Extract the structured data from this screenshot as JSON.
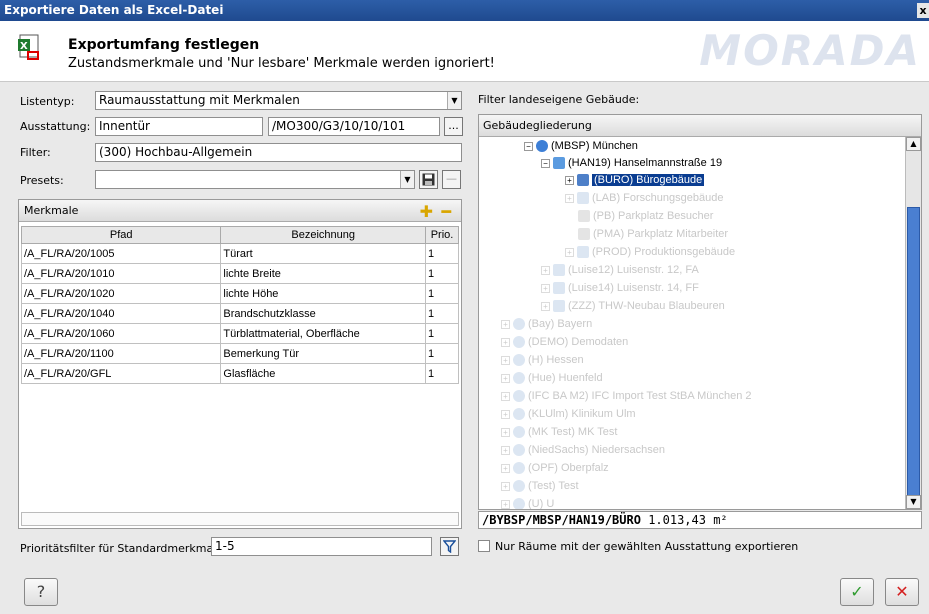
{
  "window": {
    "title": "Exportiere Daten als Excel-Datei",
    "close": "x"
  },
  "header": {
    "title": "Exportumfang festlegen",
    "subtitle": "Zustandsmerkmale und 'Nur lesbare' Merkmale werden ignoriert!",
    "watermark": "MORADA"
  },
  "form": {
    "listentyp_label": "Listentyp:",
    "listentyp_value": "Raumausstattung mit Merkmalen",
    "ausstattung_label": "Ausstattung:",
    "ausstattung_value": "Innentür",
    "ausstattung_path": "/MO300/G3/10/10/101",
    "browse_label": "...",
    "filter_label": "Filter:",
    "filter_value": "(300) Hochbau-Allgemein",
    "presets_label": "Presets:",
    "presets_value": ""
  },
  "merkmale": {
    "title": "Merkmale",
    "columns": [
      "Pfad",
      "Bezeichnung",
      "Prio."
    ],
    "rows": [
      [
        "/A_FL/RA/20/1005",
        "Türart",
        "1"
      ],
      [
        "/A_FL/RA/20/1010",
        "lichte Breite",
        "1"
      ],
      [
        "/A_FL/RA/20/1020",
        "lichte Höhe",
        "1"
      ],
      [
        "/A_FL/RA/20/1040",
        "Brandschutzklasse",
        "1"
      ],
      [
        "/A_FL/RA/20/1060",
        "Türblattmaterial, Oberfläche",
        "1"
      ],
      [
        "/A_FL/RA/20/1100",
        "Bemerkung Tür",
        "1"
      ],
      [
        "/A_FL/RA/20/GFL",
        "Glasfläche",
        "1"
      ]
    ]
  },
  "prio_filter": {
    "label": "Prioritätsfilter für Standardmerkmale:",
    "value": "1-5"
  },
  "right": {
    "filter_label": "Filter landeseigene Gebäude:",
    "tree_header": "Gebäudegliederung",
    "nodes": [
      "(MBSP) München",
      "(HAN19) Hanselmannstraße 19",
      "(BÜRO) Bürogebäude",
      "(LAB) Forschungsgebäude",
      "(PB) Parkplatz Besucher",
      "(PMA) Parkplatz Mitarbeiter",
      "(PROD) Produktionsgebäude",
      "(Luise12) Luisenstr. 12, FA",
      "(Luise14) Luisenstr. 14, FF",
      "(ZZZ) THW-Neubau Blaubeuren",
      "(Bay) Bayern",
      "(DEMO) Demodaten",
      "(H) Hessen",
      "(Hue) Huenfeld",
      "(IFC BA M2) IFC Import Test StBA München 2",
      "(KLUlm) Klinikum Ulm",
      "(MK Test) MK Test",
      "(NiedSachs) Niedersachsen",
      "(OPF) Oberpfalz",
      "(Test) Test",
      "(U) U"
    ],
    "path": "/BYBSP/MBSP/HAN19/BÜRO",
    "area": "1.013,43 m²",
    "checkbox_label": "Nur Räume mit der gewählten Ausstattung exportieren"
  },
  "buttons": {
    "help": "?",
    "ok": "✓",
    "cancel": "✕"
  },
  "colors": {
    "titlebar": "#1f4a8f",
    "selection": "#0a3d91",
    "ok": "#2e9b2e",
    "cancel": "#d42020",
    "add": "#d9a600"
  }
}
